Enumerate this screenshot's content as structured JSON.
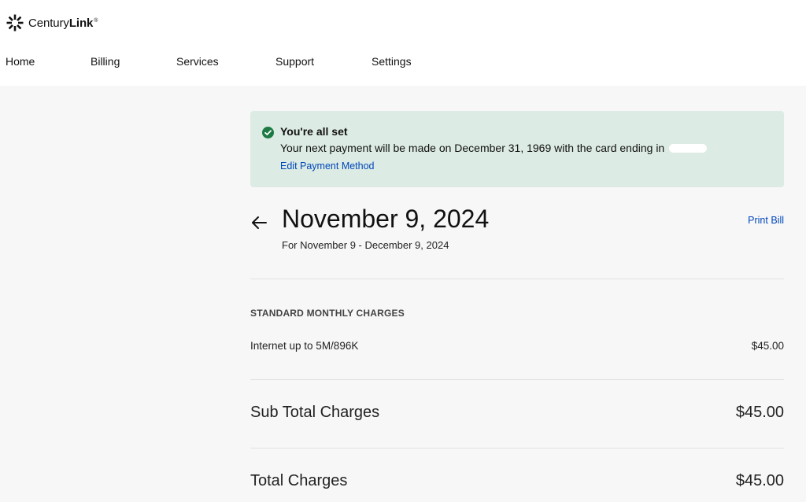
{
  "header": {
    "brand_part1": "Century",
    "brand_part2": "Link",
    "brand_tm": "®",
    "brand_color": "#111111"
  },
  "nav": {
    "items": [
      {
        "label": "Home"
      },
      {
        "label": "Billing"
      },
      {
        "label": "Services"
      },
      {
        "label": "Support"
      },
      {
        "label": "Settings"
      }
    ]
  },
  "banner": {
    "title": "You're all set",
    "message": "Your next payment will be made on December 31, 1969 with the card ending in",
    "link": "Edit Payment Method",
    "background": "#dcebe3",
    "icon": "check-circle-icon",
    "icon_color": "#1d7a43"
  },
  "bill": {
    "date": "November 9, 2024",
    "period": "For November 9 - December 9, 2024",
    "print_label": "Print Bill",
    "back_icon": "arrow-left-icon"
  },
  "charges": {
    "section_title": "STANDARD MONTHLY CHARGES",
    "items": [
      {
        "label": "Internet up to 5M/896K",
        "amount": "$45.00"
      }
    ],
    "subtotal_label": "Sub Total Charges",
    "subtotal_amount": "$45.00",
    "total_label": "Total Charges",
    "total_amount": "$45.00"
  },
  "link_color": "#0047bb"
}
